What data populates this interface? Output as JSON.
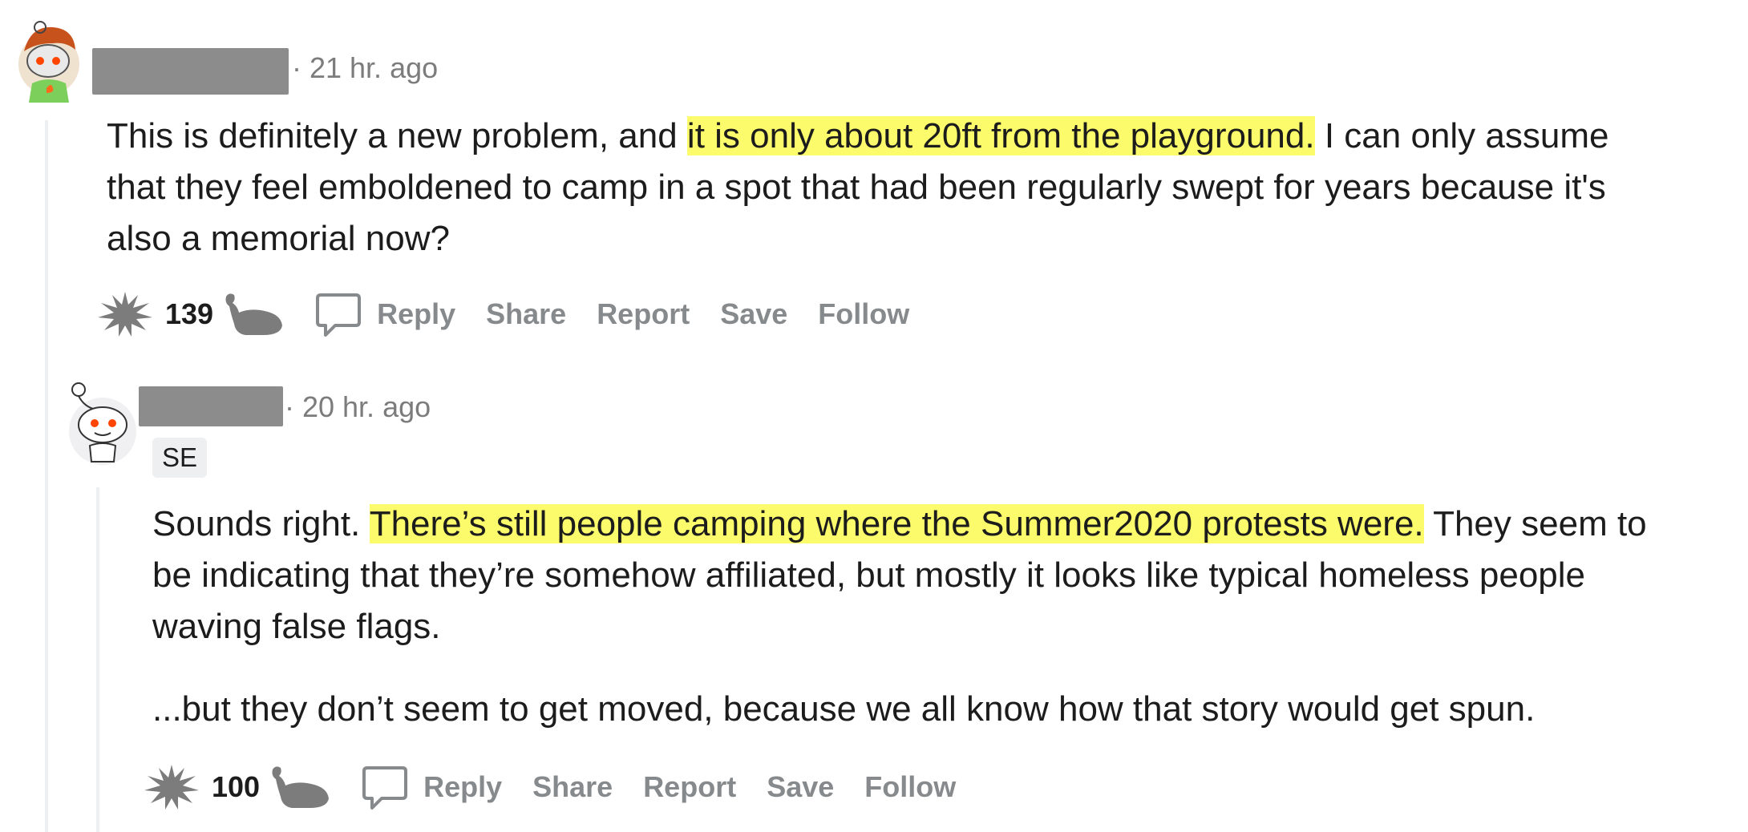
{
  "comments": [
    {
      "username": "",
      "timestamp": "· 21 hr. ago",
      "flair": "",
      "paragraphs": [
        {
          "before": "This is definitely a new problem, and ",
          "highlight": "it is only about 20ft from the playground.",
          "after": " I can only assume that they feel emboldened to camp in a spot that had been regularly swept for years because it's also a memorial now?"
        }
      ],
      "score": "139",
      "actions": {
        "reply": "Reply",
        "share": "Share",
        "report": "Report",
        "save": "Save",
        "follow": "Follow"
      }
    },
    {
      "username": "",
      "timestamp": "· 20 hr. ago",
      "flair": "SE",
      "paragraphs": [
        {
          "before": "Sounds right. ",
          "highlight": "There’s still people camping where the Summer2020 protests were.",
          "after": " They seem to be indicating that they’re somehow affiliated, but mostly it looks like typical homeless people waving false flags."
        },
        {
          "before": "...but they don’t seem to get moved, because we all know how that story would get spun.",
          "highlight": "",
          "after": ""
        }
      ],
      "score": "100",
      "actions": {
        "reply": "Reply",
        "share": "Share",
        "report": "Report",
        "save": "Save",
        "follow": "Follow"
      }
    }
  ],
  "icons": {
    "upvote": "spiky-burst-icon",
    "downvote": "whale-icon",
    "reply": "comment-bubble-icon",
    "avatar1": "snoo-avatar-orange-hair",
    "avatar2": "snoo-avatar-default"
  },
  "colors": {
    "highlight": "#fbfb6b",
    "muted": "#878a8c",
    "thread": "#edeff1"
  }
}
